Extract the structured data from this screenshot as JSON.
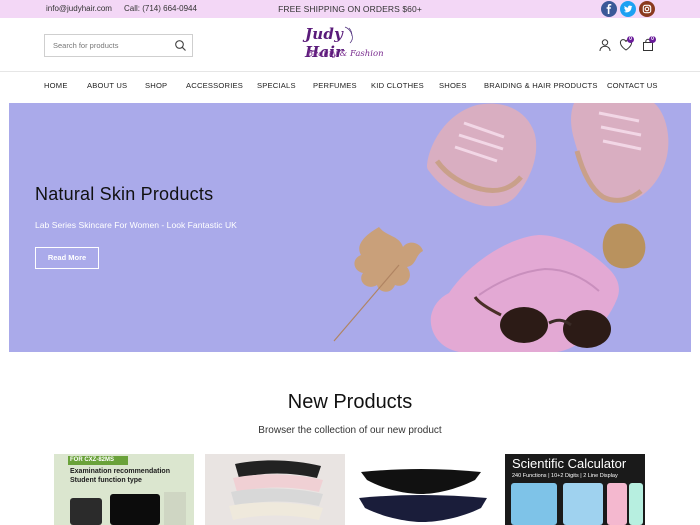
{
  "topbar": {
    "email": "info@judyhair.com",
    "phone": "Call: (714) 664-0944",
    "promo": "FREE SHIPPING ON ORDERS $60+",
    "social": [
      "facebook-icon",
      "twitter-icon",
      "instagram-icon"
    ]
  },
  "header": {
    "search_placeholder": "Search for products",
    "logo_line1": "Judy Hair",
    "logo_line2": "Beauty & Fashion",
    "wishlist_count": "0",
    "cart_count": "0"
  },
  "nav": {
    "items": [
      "HOME",
      "ABOUT US",
      "SHOP",
      "ACCESSORIES",
      "SPECIALS",
      "PERFUMES",
      "KID CLOTHES",
      "SHOES",
      "BRAIDING & HAIR PRODUCTS",
      "CONTACT US"
    ]
  },
  "hero": {
    "title": "Natural Skin Products",
    "subtitle": "Lab Series Skincare For Women - Look Fantastic UK",
    "button": "Read More"
  },
  "products": {
    "title": "New Products",
    "subtitle": "Browser the collection of our new product",
    "p1_tag": "FOR CXZ-82MS",
    "p1_line1": "Examination recommendation",
    "p1_line2": "Student function type",
    "p4_title": "Scientific Calculator",
    "p4_sub": "240 Functions | 10+2 Digits | 2 Line Display"
  },
  "colors": {
    "topbar_bg": "#f3d7f6",
    "brand_purple": "#6a1b9a",
    "hero_bg": "#aaaaea"
  }
}
